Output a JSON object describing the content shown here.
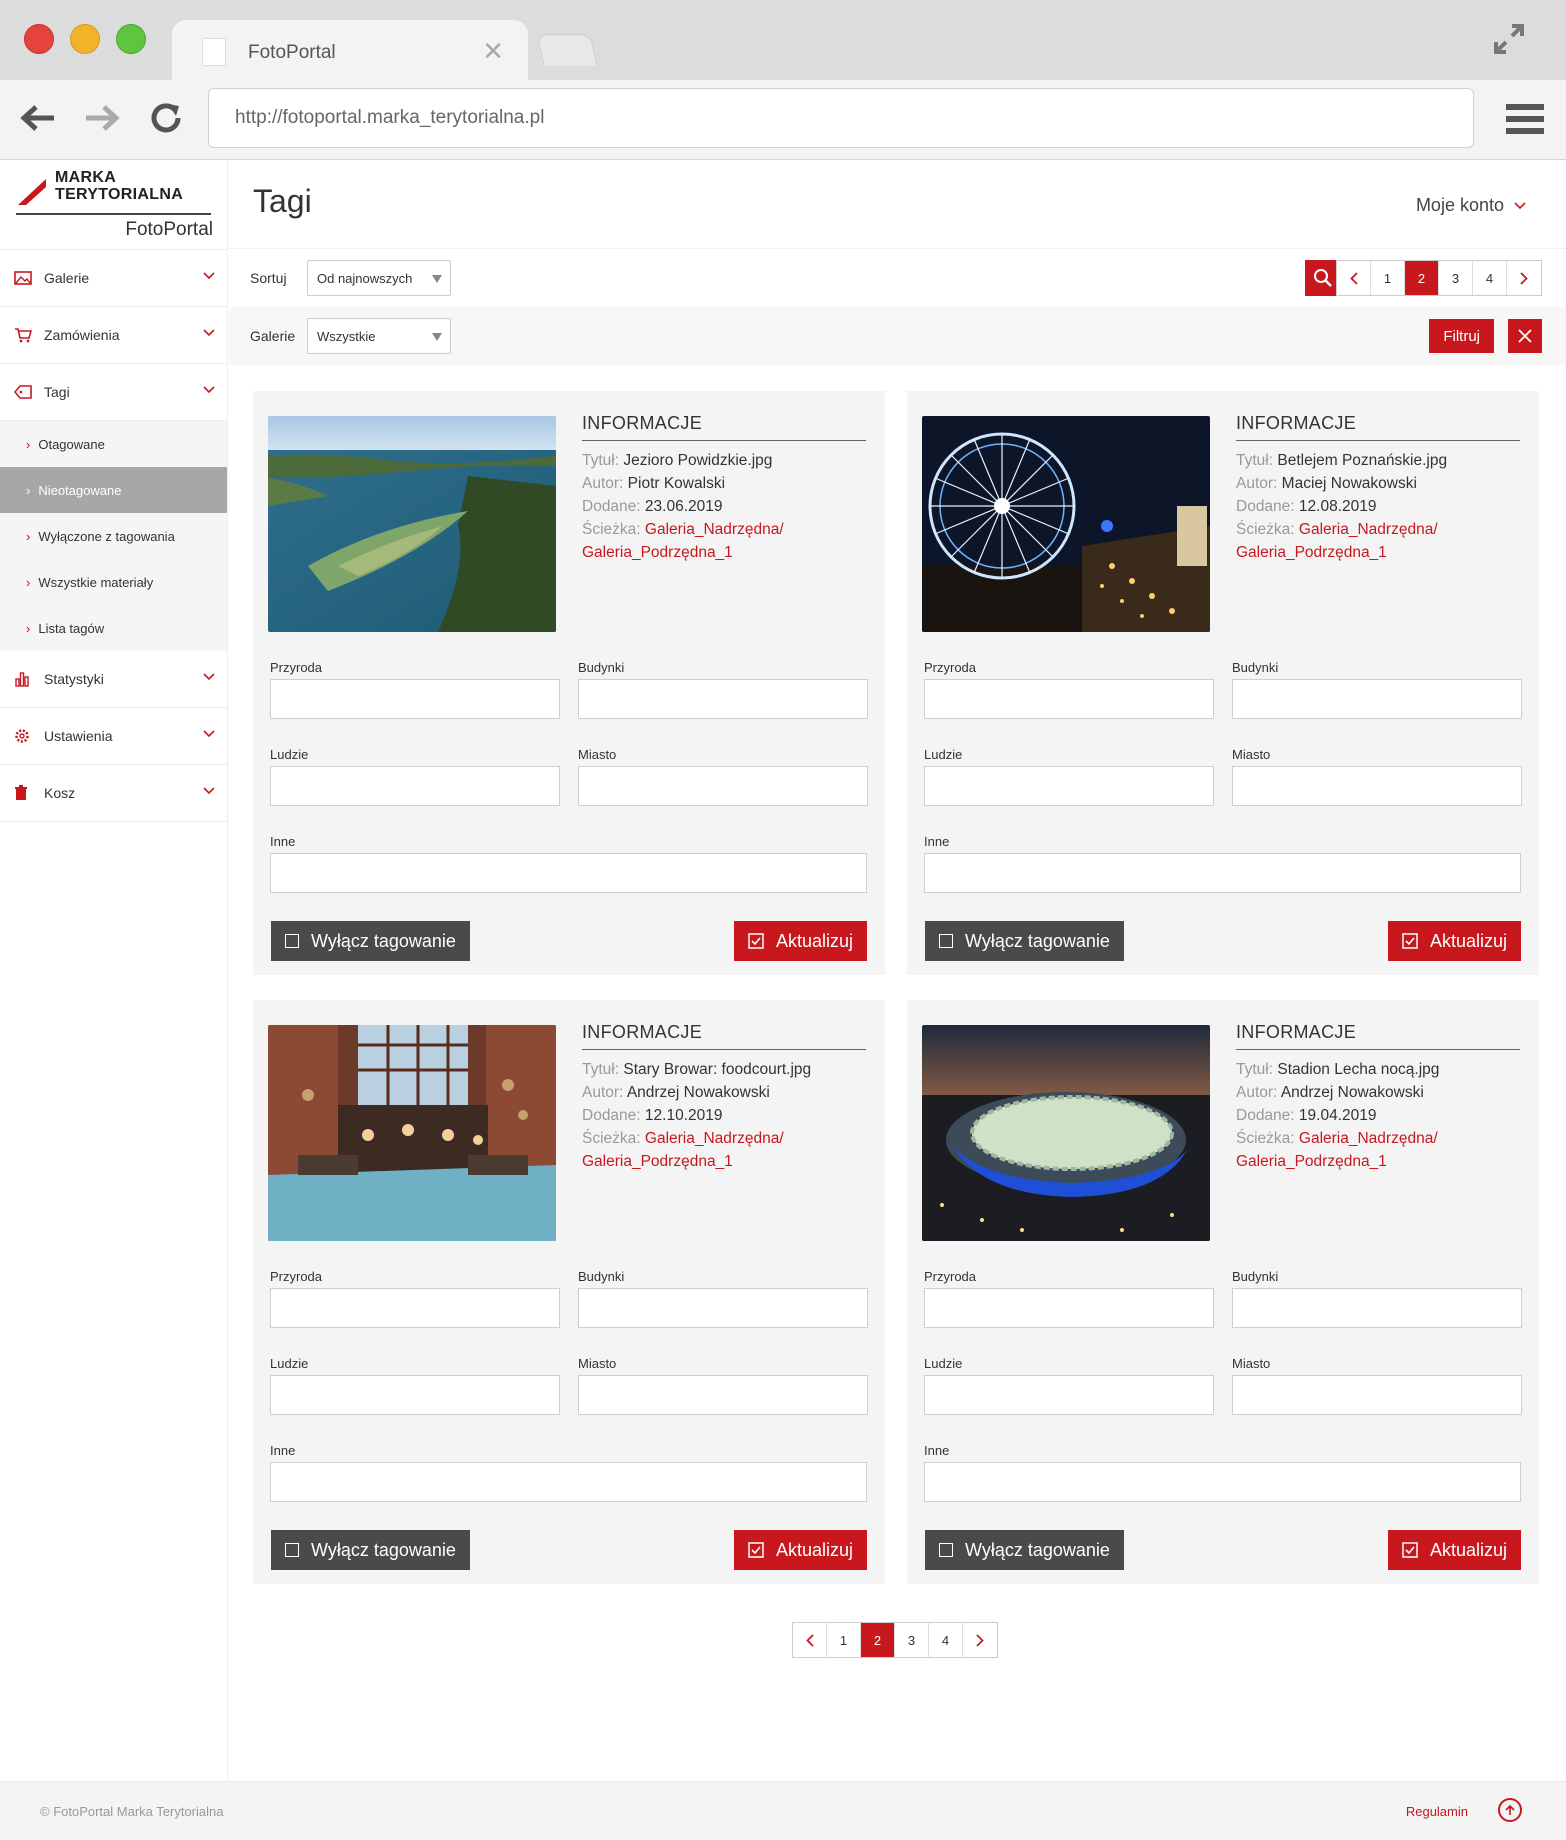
{
  "browser": {
    "tab_title": "FotoPortal",
    "url": "http://fotoportal.marka_terytorialna.pl"
  },
  "brand": {
    "logo_line1": "MARKA",
    "logo_line2": "TERYTORIALNA",
    "app_name": "FotoPortal"
  },
  "sidebar": {
    "items": [
      {
        "label": "Galerie",
        "icon": "gallery-icon"
      },
      {
        "label": "Zamówienia",
        "icon": "cart-icon"
      },
      {
        "label": "Tagi",
        "icon": "tag-icon"
      }
    ],
    "tag_sub": [
      {
        "label": "Otagowane"
      },
      {
        "label": "Nieotagowane",
        "active": true
      },
      {
        "label": "Wyłączone z tagowania"
      },
      {
        "label": "Wszystkie materiały"
      },
      {
        "label": "Lista tagów"
      }
    ],
    "items_after": [
      {
        "label": "Statystyki",
        "icon": "stats-icon"
      },
      {
        "label": "Ustawienia",
        "icon": "settings-gear-icon"
      },
      {
        "label": "Kosz",
        "icon": "trash-icon"
      }
    ]
  },
  "header": {
    "title": "Tagi",
    "account": "Moje konto"
  },
  "filters": {
    "sort_label": "Sortuj",
    "sort_value": "Od najnowszych",
    "gallery_label": "Galerie",
    "gallery_value": "Wszystkie",
    "filter_button": "Filtruj"
  },
  "pagination": {
    "pages": [
      "1",
      "2",
      "3",
      "4"
    ],
    "current": "2"
  },
  "card_labels": {
    "info_title": "INFORMACJE",
    "title_key": "Tytuł:",
    "author_key": "Autor:",
    "date_key": "Dodane:",
    "path_key": "Ścieżka:",
    "field_nature": "Przyroda",
    "field_buildings": "Budynki",
    "field_people": "Ludzie",
    "field_city": "Miasto",
    "field_other": "Inne",
    "disable_button": "Wyłącz tagowanie",
    "update_button": "Aktualizuj"
  },
  "cards": [
    {
      "title": "Jezioro Powidzkie.jpg",
      "author": "Piotr Kowalski",
      "date": "23.06.2019",
      "path1": "Galeria_Nadrzędna/",
      "path2": "Galeria_Podrzędna_1"
    },
    {
      "title": "Betlejem Poznańskie.jpg",
      "author": "Maciej Nowakowski",
      "date": "12.08.2019",
      "path1": "Galeria_Nadrzędna/",
      "path2": "Galeria_Podrzędna_1"
    },
    {
      "title": "Stary Browar: foodcourt.jpg",
      "author": "Andrzej Nowakowski",
      "date": "12.10.2019",
      "path1": "Galeria_Nadrzędna/",
      "path2": "Galeria_Podrzędna_1"
    },
    {
      "title": "Stadion Lecha nocą.jpg",
      "author": "Andrzej Nowakowski",
      "date": "19.04.2019",
      "path1": "Galeria_Nadrzędna/",
      "path2": "Galeria_Podrzędna_1"
    }
  ],
  "footer": {
    "copyright": "© FotoPortal Marka Terytorialna",
    "terms": "Regulamin"
  },
  "colors": {
    "accent": "#c8181e",
    "dark_button": "#4a4a4a",
    "active_nav": "#a7a7a7"
  }
}
